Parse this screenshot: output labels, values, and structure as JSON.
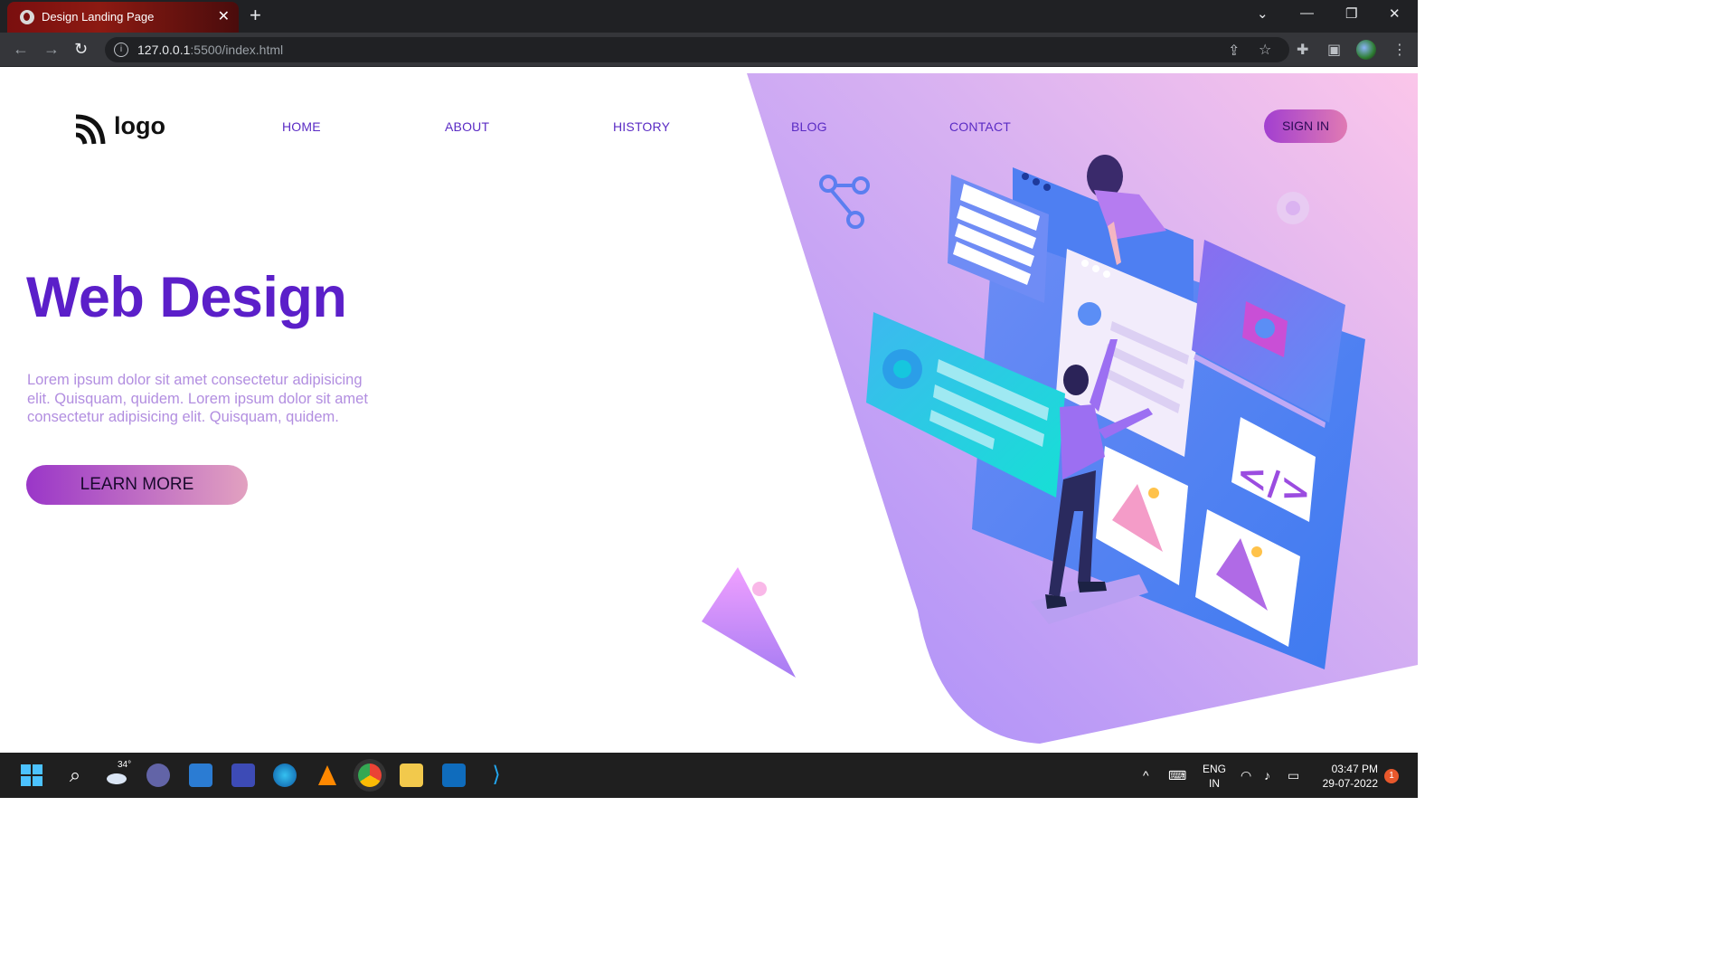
{
  "browser": {
    "tab_title": "Design Landing Page",
    "url_host": "127.0.0.1",
    "url_rest": ":5500/index.html"
  },
  "nav": {
    "logo_text": "logo",
    "links": [
      "HOME",
      "ABOUT",
      "HISTORY",
      "BLOG",
      "CONTACT"
    ],
    "signin_label": "SIGN IN"
  },
  "hero": {
    "title": "Web Design",
    "text": "Lorem ipsum dolor sit amet consectetur adipisicing elit. Quisquam, quidem. Lorem ipsum dolor sit amet consectetur adipisicing elit. Quisquam, quidem.",
    "button_label": "LEARN MORE"
  },
  "taskbar": {
    "weather": "34°",
    "lang_line1": "ENG",
    "lang_line2": "IN",
    "time": "03:47 PM",
    "date": "29-07-2022",
    "notification_count": "1"
  },
  "colors": {
    "accent": "#5b1fc9",
    "hero_gradient_start": "#a78bfa",
    "hero_gradient_end": "#fbc6ea",
    "button_start": "#9a36c8",
    "button_end": "#e2a1c0"
  }
}
